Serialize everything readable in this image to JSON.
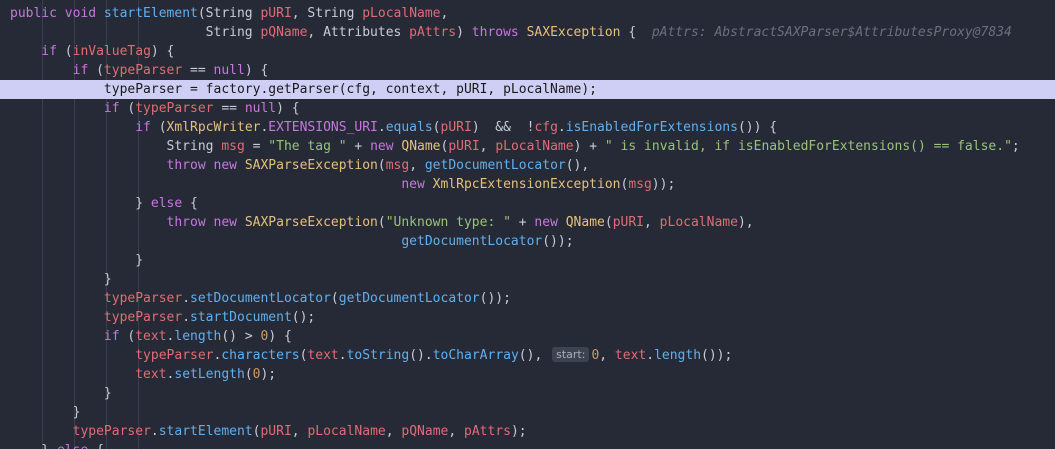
{
  "editor": {
    "lines": [
      {
        "highlight": false,
        "tokens": [
          {
            "c": "kw",
            "t": "public void "
          },
          {
            "c": "fn",
            "t": "startElement"
          },
          {
            "c": "plain",
            "t": "(String "
          },
          {
            "c": "var",
            "t": "pURI"
          },
          {
            "c": "plain",
            "t": ", String "
          },
          {
            "c": "var",
            "t": "pLocalName"
          },
          {
            "c": "plain",
            "t": ","
          }
        ]
      },
      {
        "highlight": false,
        "tokens": [
          {
            "c": "plain",
            "t": "                         String "
          },
          {
            "c": "var",
            "t": "pQName"
          },
          {
            "c": "plain",
            "t": ", Attributes "
          },
          {
            "c": "var",
            "t": "pAttrs"
          },
          {
            "c": "plain",
            "t": ") "
          },
          {
            "c": "kw",
            "t": "throws "
          },
          {
            "c": "type",
            "t": "SAXException"
          },
          {
            "c": "plain",
            "t": " {  "
          },
          {
            "c": "hint",
            "t": "pAttrs: AbstractSAXParser$AttributesProxy@7834"
          }
        ]
      },
      {
        "highlight": false,
        "tokens": [
          {
            "c": "kw",
            "t": "    if "
          },
          {
            "c": "plain",
            "t": "("
          },
          {
            "c": "var",
            "t": "inValueTag"
          },
          {
            "c": "plain",
            "t": ") {"
          }
        ]
      },
      {
        "highlight": false,
        "tokens": [
          {
            "c": "kw",
            "t": "        if "
          },
          {
            "c": "plain",
            "t": "("
          },
          {
            "c": "var",
            "t": "typeParser"
          },
          {
            "c": "plain",
            "t": " == "
          },
          {
            "c": "kw",
            "t": "null"
          },
          {
            "c": "plain",
            "t": ") {"
          }
        ]
      },
      {
        "highlight": true,
        "tokens": [
          {
            "c": "plain",
            "t": "            typeParser = factory.getParser(cfg, context, pURI, pLocalName);"
          }
        ]
      },
      {
        "highlight": false,
        "tokens": [
          {
            "c": "kw",
            "t": "            if "
          },
          {
            "c": "plain",
            "t": "("
          },
          {
            "c": "var",
            "t": "typeParser"
          },
          {
            "c": "plain",
            "t": " == "
          },
          {
            "c": "kw",
            "t": "null"
          },
          {
            "c": "plain",
            "t": ") {"
          }
        ]
      },
      {
        "highlight": false,
        "tokens": [
          {
            "c": "kw",
            "t": "                if "
          },
          {
            "c": "plain",
            "t": "("
          },
          {
            "c": "type",
            "t": "XmlRpcWriter"
          },
          {
            "c": "plain",
            "t": "."
          },
          {
            "c": "field",
            "t": "EXTENSIONS_URI"
          },
          {
            "c": "plain",
            "t": "."
          },
          {
            "c": "fn",
            "t": "equals"
          },
          {
            "c": "plain",
            "t": "("
          },
          {
            "c": "var",
            "t": "pURI"
          },
          {
            "c": "plain",
            "t": ")  &&  !"
          },
          {
            "c": "var",
            "t": "cfg"
          },
          {
            "c": "plain",
            "t": "."
          },
          {
            "c": "fn",
            "t": "isEnabledForExtensions"
          },
          {
            "c": "plain",
            "t": "()) {"
          }
        ]
      },
      {
        "highlight": false,
        "tokens": [
          {
            "c": "plain",
            "t": "                    String "
          },
          {
            "c": "var",
            "t": "msg"
          },
          {
            "c": "plain",
            "t": " = "
          },
          {
            "c": "str",
            "t": "\"The tag \""
          },
          {
            "c": "plain",
            "t": " + "
          },
          {
            "c": "kw",
            "t": "new "
          },
          {
            "c": "type",
            "t": "QName"
          },
          {
            "c": "plain",
            "t": "("
          },
          {
            "c": "var",
            "t": "pURI"
          },
          {
            "c": "plain",
            "t": ", "
          },
          {
            "c": "var",
            "t": "pLocalName"
          },
          {
            "c": "plain",
            "t": ") + "
          },
          {
            "c": "str",
            "t": "\" is invalid, if isEnabledForExtensions() == false.\""
          },
          {
            "c": "plain",
            "t": ";"
          }
        ]
      },
      {
        "highlight": false,
        "tokens": [
          {
            "c": "kw",
            "t": "                    throw new "
          },
          {
            "c": "type",
            "t": "SAXParseException"
          },
          {
            "c": "plain",
            "t": "("
          },
          {
            "c": "var",
            "t": "msg"
          },
          {
            "c": "plain",
            "t": ", "
          },
          {
            "c": "fn",
            "t": "getDocumentLocator"
          },
          {
            "c": "plain",
            "t": "(),"
          }
        ]
      },
      {
        "highlight": false,
        "tokens": [
          {
            "c": "kw",
            "t": "                                                  new "
          },
          {
            "c": "type",
            "t": "XmlRpcExtensionException"
          },
          {
            "c": "plain",
            "t": "("
          },
          {
            "c": "var",
            "t": "msg"
          },
          {
            "c": "plain",
            "t": "));"
          }
        ]
      },
      {
        "highlight": false,
        "tokens": [
          {
            "c": "plain",
            "t": "                } "
          },
          {
            "c": "kw",
            "t": "else"
          },
          {
            "c": "plain",
            "t": " {"
          }
        ]
      },
      {
        "highlight": false,
        "tokens": [
          {
            "c": "kw",
            "t": "                    throw new "
          },
          {
            "c": "type",
            "t": "SAXParseException"
          },
          {
            "c": "plain",
            "t": "("
          },
          {
            "c": "str",
            "t": "\"Unknown type: \""
          },
          {
            "c": "plain",
            "t": " + "
          },
          {
            "c": "kw",
            "t": "new "
          },
          {
            "c": "type",
            "t": "QName"
          },
          {
            "c": "plain",
            "t": "("
          },
          {
            "c": "var",
            "t": "pURI"
          },
          {
            "c": "plain",
            "t": ", "
          },
          {
            "c": "var",
            "t": "pLocalName"
          },
          {
            "c": "plain",
            "t": "),"
          }
        ]
      },
      {
        "highlight": false,
        "tokens": [
          {
            "c": "plain",
            "t": "                                                  "
          },
          {
            "c": "fn",
            "t": "getDocumentLocator"
          },
          {
            "c": "plain",
            "t": "());"
          }
        ]
      },
      {
        "highlight": false,
        "tokens": [
          {
            "c": "plain",
            "t": "                }"
          }
        ]
      },
      {
        "highlight": false,
        "tokens": [
          {
            "c": "plain",
            "t": "            }"
          }
        ]
      },
      {
        "highlight": false,
        "tokens": [
          {
            "c": "plain",
            "t": "            "
          },
          {
            "c": "var",
            "t": "typeParser"
          },
          {
            "c": "plain",
            "t": "."
          },
          {
            "c": "fn",
            "t": "setDocumentLocator"
          },
          {
            "c": "plain",
            "t": "("
          },
          {
            "c": "fn",
            "t": "getDocumentLocator"
          },
          {
            "c": "plain",
            "t": "());"
          }
        ]
      },
      {
        "highlight": false,
        "tokens": [
          {
            "c": "plain",
            "t": "            "
          },
          {
            "c": "var",
            "t": "typeParser"
          },
          {
            "c": "plain",
            "t": "."
          },
          {
            "c": "fn",
            "t": "startDocument"
          },
          {
            "c": "plain",
            "t": "();"
          }
        ]
      },
      {
        "highlight": false,
        "tokens": [
          {
            "c": "kw",
            "t": "            if "
          },
          {
            "c": "plain",
            "t": "("
          },
          {
            "c": "var",
            "t": "text"
          },
          {
            "c": "plain",
            "t": "."
          },
          {
            "c": "fn",
            "t": "length"
          },
          {
            "c": "plain",
            "t": "() > "
          },
          {
            "c": "num",
            "t": "0"
          },
          {
            "c": "plain",
            "t": ") {"
          }
        ]
      },
      {
        "highlight": false,
        "tokens": [
          {
            "c": "plain",
            "t": "                "
          },
          {
            "c": "var",
            "t": "typeParser"
          },
          {
            "c": "plain",
            "t": "."
          },
          {
            "c": "fn",
            "t": "characters"
          },
          {
            "c": "plain",
            "t": "("
          },
          {
            "c": "var",
            "t": "text"
          },
          {
            "c": "plain",
            "t": "."
          },
          {
            "c": "fn",
            "t": "toString"
          },
          {
            "c": "plain",
            "t": "()."
          },
          {
            "c": "fn",
            "t": "toCharArray"
          },
          {
            "c": "plain",
            "t": "(), "
          },
          {
            "c": "param",
            "t": "start:"
          },
          {
            "c": "num",
            "t": "0"
          },
          {
            "c": "plain",
            "t": ", "
          },
          {
            "c": "var",
            "t": "text"
          },
          {
            "c": "plain",
            "t": "."
          },
          {
            "c": "fn",
            "t": "length"
          },
          {
            "c": "plain",
            "t": "());"
          }
        ]
      },
      {
        "highlight": false,
        "tokens": [
          {
            "c": "plain",
            "t": "                "
          },
          {
            "c": "var",
            "t": "text"
          },
          {
            "c": "plain",
            "t": "."
          },
          {
            "c": "fn",
            "t": "setLength"
          },
          {
            "c": "plain",
            "t": "("
          },
          {
            "c": "num",
            "t": "0"
          },
          {
            "c": "plain",
            "t": ");"
          }
        ]
      },
      {
        "highlight": false,
        "tokens": [
          {
            "c": "plain",
            "t": "            }"
          }
        ]
      },
      {
        "highlight": false,
        "tokens": [
          {
            "c": "plain",
            "t": "        }"
          }
        ]
      },
      {
        "highlight": false,
        "tokens": [
          {
            "c": "plain",
            "t": "        "
          },
          {
            "c": "var",
            "t": "typeParser"
          },
          {
            "c": "plain",
            "t": "."
          },
          {
            "c": "fn",
            "t": "startElement"
          },
          {
            "c": "plain",
            "t": "("
          },
          {
            "c": "var",
            "t": "pURI"
          },
          {
            "c": "plain",
            "t": ", "
          },
          {
            "c": "var",
            "t": "pLocalName"
          },
          {
            "c": "plain",
            "t": ", "
          },
          {
            "c": "var",
            "t": "pQName"
          },
          {
            "c": "plain",
            "t": ", "
          },
          {
            "c": "var",
            "t": "pAttrs"
          },
          {
            "c": "plain",
            "t": ");"
          }
        ]
      },
      {
        "highlight": false,
        "tokens": [
          {
            "c": "plain",
            "t": "    } "
          },
          {
            "c": "kw",
            "t": "else"
          },
          {
            "c": "plain",
            "t": " {"
          }
        ]
      }
    ]
  }
}
